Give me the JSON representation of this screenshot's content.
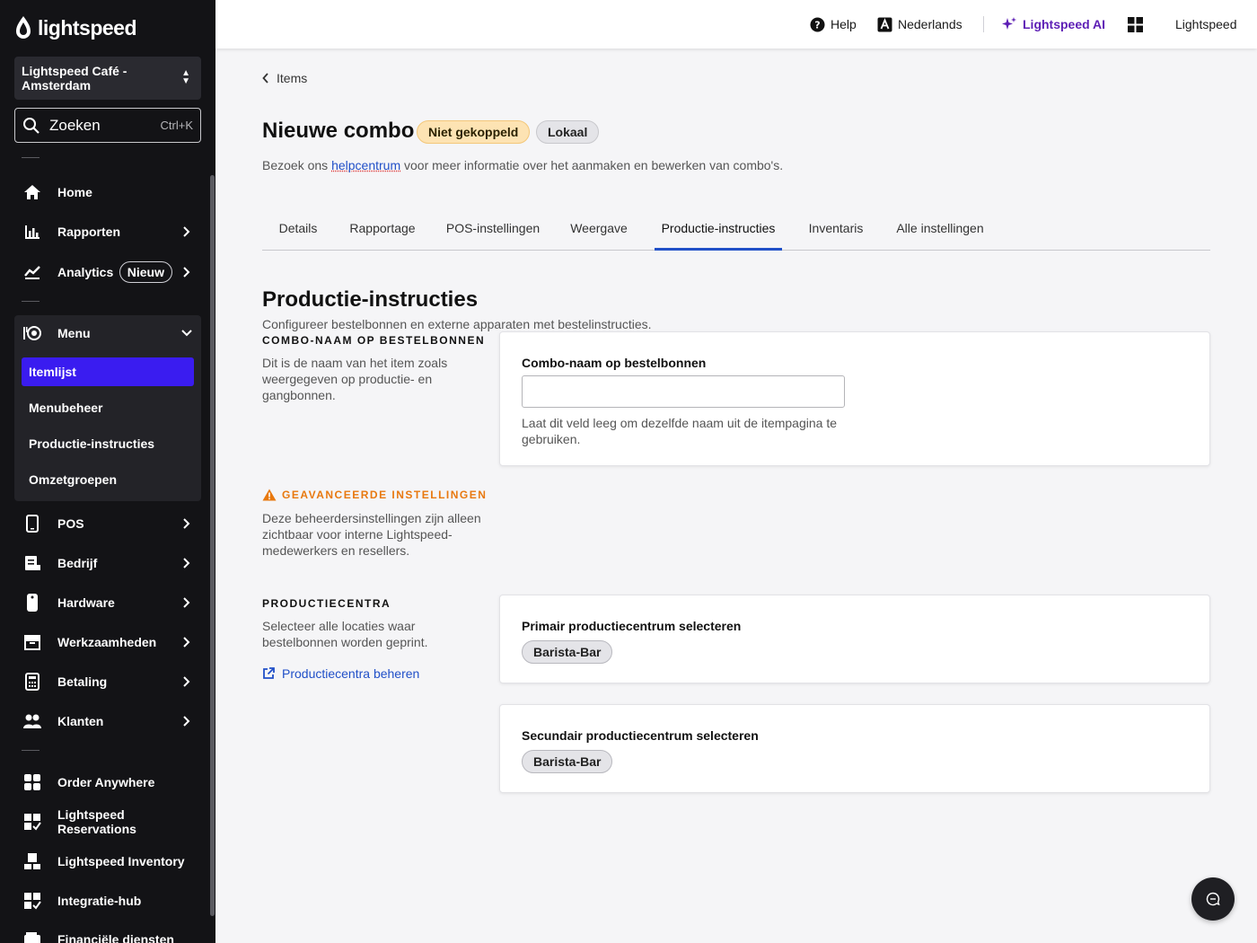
{
  "sidebar": {
    "logo_text": "lightspeed",
    "venue": "Lightspeed Café - Amsterdam",
    "search": {
      "label": "Zoeken",
      "shortcut": "Ctrl+K"
    },
    "items": [
      {
        "label": "Home",
        "icon": "home-icon"
      },
      {
        "label": "Rapporten",
        "icon": "bar-chart-icon"
      },
      {
        "label": "Analytics",
        "icon": "trend-icon",
        "badge": "Nieuw"
      },
      {
        "label": "Menu",
        "icon": "menu-book-icon"
      },
      {
        "label": "POS",
        "icon": "tablet-icon"
      },
      {
        "label": "Bedrijf",
        "icon": "business-icon"
      },
      {
        "label": "Hardware",
        "icon": "hardware-icon"
      },
      {
        "label": "Werkzaamheden",
        "icon": "archive-icon"
      },
      {
        "label": "Betaling",
        "icon": "calculator-icon"
      },
      {
        "label": "Klanten",
        "icon": "people-icon"
      },
      {
        "label": "Order Anywhere",
        "icon": "order-icon"
      },
      {
        "label": "Lightspeed Reservations",
        "icon": "reservations-icon"
      },
      {
        "label": "Lightspeed Inventory",
        "icon": "inventory-icon"
      },
      {
        "label": "Integratie-hub",
        "icon": "integration-icon"
      },
      {
        "label": "Financiële diensten",
        "icon": "wallet-icon"
      }
    ],
    "menu_sub": [
      "Itemlijst",
      "Menubeheer",
      "Productie-instructies",
      "Omzetgroepen"
    ]
  },
  "topbar": {
    "help": "Help",
    "language": "Nederlands",
    "ai": "Lightspeed AI",
    "account": "Lightspeed"
  },
  "page": {
    "back": "Items",
    "title": "Nieuwe combo",
    "status_badge": "Niet gekoppeld",
    "scope_badge": "Lokaal",
    "intro_pre": "Bezoek ons ",
    "intro_link": "helpcentrum",
    "intro_post": " voor meer informatie over het aanmaken en bewerken van combo's.",
    "tabs": [
      "Details",
      "Rapportage",
      "POS-instellingen",
      "Weergave",
      "Productie-instructies",
      "Inventaris",
      "Alle instellingen"
    ],
    "active_tab": "Productie-instructies"
  },
  "section": {
    "title": "Productie-instructies",
    "desc": "Configureer bestelbonnen en externe apparaten met bestelinstructies.",
    "combo_heading": "Combo-naam op bestelbonnen",
    "combo_help": "Dit is de naam van het item zoals weergegeven op productie- en gangbonnen.",
    "combo_card_label": "Combo-naam op bestelbonnen",
    "combo_input_value": "",
    "combo_hint": "Laat dit veld leeg om dezelfde naam uit de itempagina te gebruiken.",
    "advanced_heading": "Geavanceerde instellingen",
    "advanced_help": "Deze beheerdersinstellingen zijn alleen zichtbaar voor interne Lightspeed-medewerkers en resellers.",
    "centers_heading": "Productiecentra",
    "centers_help": "Selecteer alle locaties waar bestelbonnen worden geprint.",
    "centers_link": "Productiecentra beheren",
    "primary_label": "Primair productiecentrum selecteren",
    "primary_value": "Barista-Bar",
    "secondary_label": "Secundair productiecentrum selecteren",
    "secondary_value": "Barista-Bar"
  },
  "colors": {
    "sidebar_bg": "#131316",
    "active_nav": "#3a1cf0",
    "tab_active": "#2150c8",
    "ai_purple": "#5d1eb5",
    "warning": "#e8790f"
  }
}
